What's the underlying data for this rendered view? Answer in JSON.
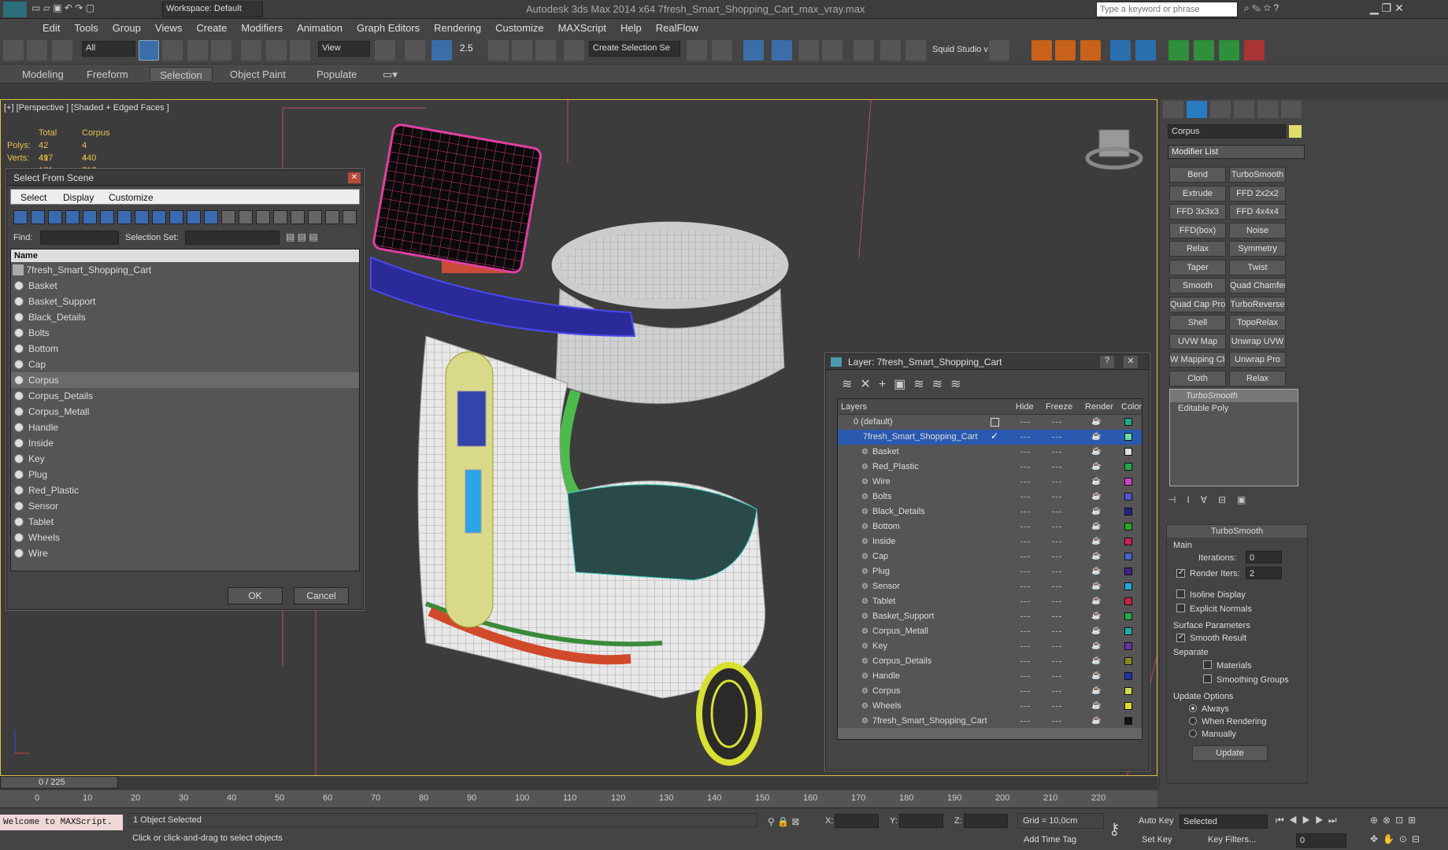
{
  "app": {
    "title": "Autodesk 3ds Max  2014 x64     7fresh_Smart_Shopping_Cart_max_vray.max",
    "workspace": "Workspace: Default",
    "search_placeholder": "Type a keyword or phrase"
  },
  "menu": [
    "Edit",
    "Tools",
    "Group",
    "Views",
    "Create",
    "Modifiers",
    "Animation",
    "Graph Editors",
    "Rendering",
    "Customize",
    "MAXScript",
    "Help",
    "RealFlow"
  ],
  "toolbar": {
    "filter": "All",
    "refcoord": "View",
    "snap_value": "2.5",
    "named_sel": "Create Selection Se",
    "squid": "Squid Studio v"
  },
  "ribbon": {
    "tabs": [
      "Modeling",
      "Freeform",
      "Selection",
      "Object Paint",
      "Populate"
    ],
    "active": "Selection"
  },
  "viewport": {
    "label": "[+] [Perspective ] [Shaded + Edged Faces ]",
    "stats": {
      "h1": "Total",
      "h2": "Corpus",
      "polys_label": "Polys:",
      "polys_total": "42 497",
      "polys_corpus": "4 440",
      "verts_label": "Verts:",
      "verts_total": "41 171",
      "verts_corpus": "4 717"
    }
  },
  "select_dialog": {
    "title": "Select From Scene",
    "menu": [
      "Select",
      "Display",
      "Customize"
    ],
    "find_label": "Find:",
    "selset_label": "Selection Set:",
    "col_name": "Name",
    "root": "7fresh_Smart_Shopping_Cart",
    "items": [
      "Basket",
      "Basket_Support",
      "Black_Details",
      "Bolts",
      "Bottom",
      "Cap",
      "Corpus",
      "Corpus_Details",
      "Corpus_Metall",
      "Handle",
      "Inside",
      "Key",
      "Plug",
      "Red_Plastic",
      "Sensor",
      "Tablet",
      "Wheels",
      "Wire"
    ],
    "selected": "Corpus",
    "ok": "OK",
    "cancel": "Cancel"
  },
  "layer_dialog": {
    "title": "Layer: 7fresh_Smart_Shopping_Cart",
    "cols": [
      "Layers",
      "Hide",
      "Freeze",
      "Render",
      "Color"
    ],
    "default_layer": "0 (default)",
    "active_layer": "7fresh_Smart_Shopping_Cart",
    "items": [
      {
        "name": "Basket",
        "color": "#e0e0e0"
      },
      {
        "name": "Red_Plastic",
        "color": "#22aa44"
      },
      {
        "name": "Wire",
        "color": "#cc44cc"
      },
      {
        "name": "Bolts",
        "color": "#5555dd"
      },
      {
        "name": "Black_Details",
        "color": "#222288"
      },
      {
        "name": "Bottom",
        "color": "#22aa22"
      },
      {
        "name": "Inside",
        "color": "#cc2255"
      },
      {
        "name": "Cap",
        "color": "#4466cc"
      },
      {
        "name": "Plug",
        "color": "#442288"
      },
      {
        "name": "Sensor",
        "color": "#22aadd"
      },
      {
        "name": "Tablet",
        "color": "#cc2244"
      },
      {
        "name": "Basket_Support",
        "color": "#22aa44"
      },
      {
        "name": "Corpus_Metall",
        "color": "#22aaaa"
      },
      {
        "name": "Key",
        "color": "#6633aa"
      },
      {
        "name": "Corpus_Details",
        "color": "#888822"
      },
      {
        "name": "Handle",
        "color": "#2233aa"
      },
      {
        "name": "Corpus",
        "color": "#ccdd44"
      },
      {
        "name": "Wheels",
        "color": "#dddd22"
      },
      {
        "name": "7fresh_Smart_Shopping_Cart",
        "color": "#111111"
      }
    ]
  },
  "command_panel": {
    "object_name": "Corpus",
    "modifier_list": "Modifier List",
    "mod_buttons": [
      "Bend",
      "TurboSmooth",
      "Extrude",
      "FFD 2x2x2",
      "FFD 3x3x3",
      "FFD 4x4x4",
      "FFD(box)",
      "Noise",
      "Relax",
      "Symmetry",
      "Taper",
      "Twist",
      "Smooth",
      "Quad Chamfer",
      "Quad Cap Pro",
      "TurboReverse",
      "Shell",
      "TopoRelax",
      "UVW Map",
      "Unwrap UVW",
      "W Mapping Cle",
      "Unwrap Pro",
      "Cloth",
      "Relax"
    ],
    "stack": [
      "TurboSmooth",
      "Editable Poly"
    ],
    "rollout": {
      "title": "TurboSmooth",
      "main": "Main",
      "iterations_label": "Iterations:",
      "iterations": "0",
      "render_iters_label": "Render Iters:",
      "render_iters": "2",
      "isoline": "Isoline Display",
      "explicit": "Explicit Normals",
      "surface": "Surface Parameters",
      "smooth_result": "Smooth Result",
      "separate": "Separate",
      "materials": "Materials",
      "smoothing": "Smoothing Groups",
      "update_opts": "Update Options",
      "always": "Always",
      "when_rendering": "When Rendering",
      "manually": "Manually",
      "update": "Update"
    }
  },
  "timeline": {
    "frame": "0 / 225",
    "ticks": [
      "0",
      "10",
      "20",
      "30",
      "40",
      "50",
      "60",
      "70",
      "80",
      "90",
      "100",
      "110",
      "120",
      "130",
      "140",
      "150",
      "160",
      "170",
      "180",
      "190",
      "200",
      "210",
      "220"
    ]
  },
  "status": {
    "maxscript": "Welcome to MAXScript.",
    "selected": "1 Object Selected",
    "prompt": "Click or click-and-drag to select objects",
    "x": "X:",
    "y": "Y:",
    "z": "Z:",
    "grid": "Grid = 10,0cm",
    "add_time_tag": "Add Time Tag",
    "auto_key": "Auto Key",
    "set_key": "Set Key",
    "key_mode": "Selected",
    "key_filters": "Key Filters...",
    "frame_field": "0"
  }
}
